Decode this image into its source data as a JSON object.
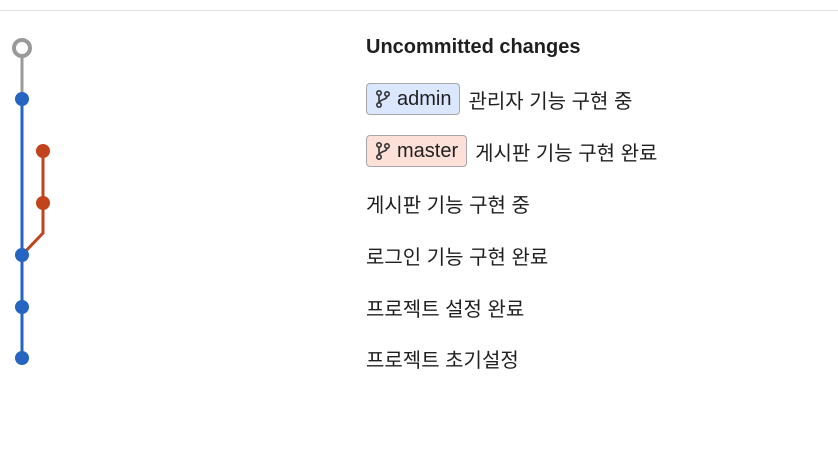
{
  "commits": [
    {
      "message": "Uncommitted changes",
      "type": "uncommitted"
    },
    {
      "message": "관리자 기능 구현 중",
      "branch": {
        "name": "admin",
        "color": "#dbe7ff"
      }
    },
    {
      "message": "게시판 기능 구현 완료",
      "branch": {
        "name": "master",
        "color": "#fde0d8"
      }
    },
    {
      "message": "게시판 기능 구현 중"
    },
    {
      "message": "로그인 기능 구현 완료"
    },
    {
      "message": "프로젝트 설정 완료"
    },
    {
      "message": "프로젝트 초기설정"
    }
  ],
  "colors": {
    "uncommitted": "#9a9a9a",
    "admin_line": "#2564c0",
    "master_line": "#c2441c"
  },
  "icons": {
    "branch": "git-branch-icon"
  }
}
